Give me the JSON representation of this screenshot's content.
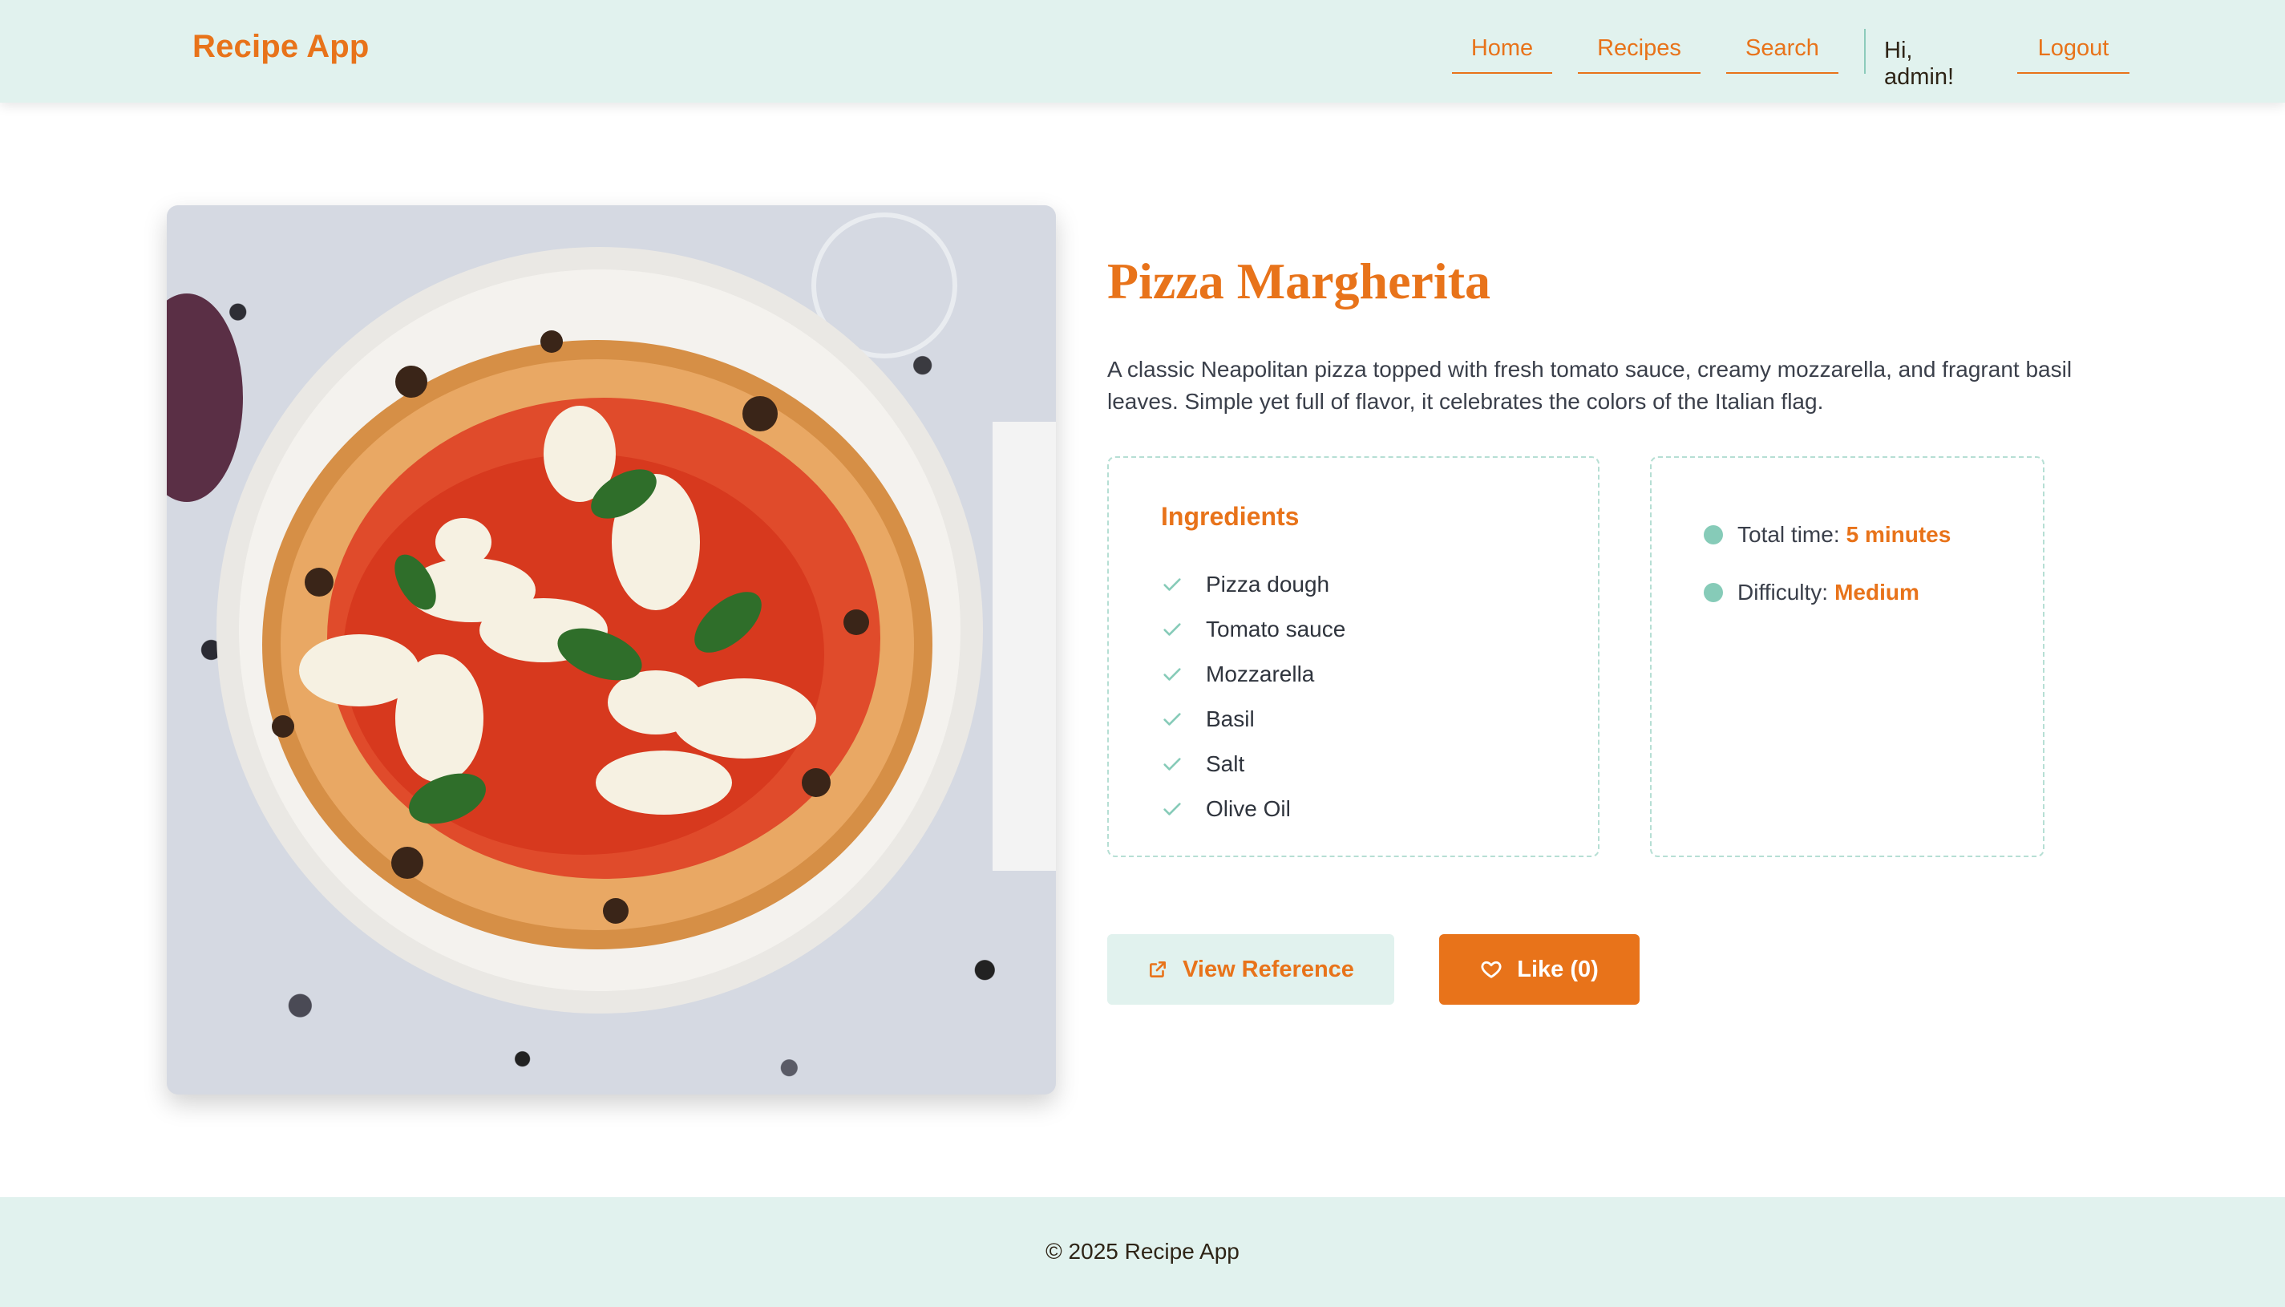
{
  "header": {
    "brand": "Recipe App",
    "nav": {
      "home": "Home",
      "recipes": "Recipes",
      "search": "Search",
      "greeting": "Hi, admin!",
      "logout": "Logout"
    }
  },
  "recipe": {
    "image_alt": "Pizza Margherita photo",
    "title": "Pizza Margherita",
    "description": "A classic Neapolitan pizza topped with fresh tomato sauce, creamy mozzarella, and fragrant basil leaves. Simple yet full of flavor, it celebrates the colors of the Italian flag.",
    "ingredients_title": "Ingredients",
    "ingredients": [
      "Pizza dough",
      "Tomato sauce",
      "Mozzarella",
      "Basil",
      "Salt",
      "Olive Oil"
    ],
    "meta": {
      "time_label": "Total time:",
      "time_value": "5 minutes",
      "difficulty_label": "Difficulty:",
      "difficulty_value": "Medium"
    }
  },
  "actions": {
    "reference_label": "View Reference",
    "like_label": "Like (0)"
  },
  "footer": {
    "text": "© 2025 Recipe App"
  },
  "icons": {
    "check": "check-icon",
    "dot": "dot-icon",
    "external_link": "external-link-icon",
    "heart": "heart-icon"
  },
  "colors": {
    "accent": "#e8731a",
    "mint": "#e1f2ee",
    "mint_dark": "#86cbb8"
  }
}
